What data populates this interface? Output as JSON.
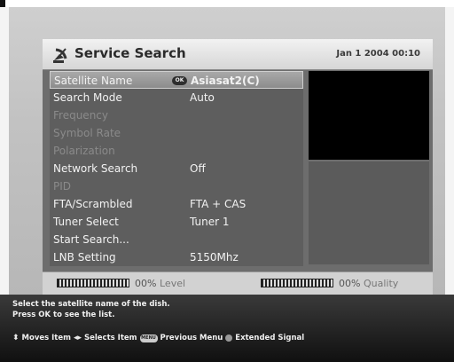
{
  "header": {
    "title": "Service Search",
    "datetime": "Jan 1 2004 00:10",
    "icon": "satellite-dish-icon"
  },
  "menu": {
    "ok_badge": "OK",
    "items": [
      {
        "label": "Satellite Name",
        "value": "Asiasat2(C)",
        "state": "selected"
      },
      {
        "label": "Search Mode",
        "value": "Auto",
        "state": "enabled"
      },
      {
        "label": "Frequency",
        "value": "",
        "state": "disabled"
      },
      {
        "label": "Symbol Rate",
        "value": "",
        "state": "disabled"
      },
      {
        "label": "Polarization",
        "value": "",
        "state": "disabled"
      },
      {
        "label": "Network Search",
        "value": "Off",
        "state": "enabled"
      },
      {
        "label": "PID",
        "value": "",
        "state": "disabled"
      },
      {
        "label": "FTA/Scrambled",
        "value": "FTA + CAS",
        "state": "enabled"
      },
      {
        "label": "Tuner Select",
        "value": "Tuner 1",
        "state": "enabled"
      },
      {
        "label": "Start Search...",
        "value": "",
        "state": "enabled"
      },
      {
        "label": "LNB Setting",
        "value": "5150Mhz",
        "state": "enabled"
      }
    ]
  },
  "meters": {
    "level": {
      "percent": "00%",
      "label": "Level",
      "fill_fraction": 0
    },
    "quality": {
      "percent": "00%",
      "label": "Quality",
      "fill_fraction": 0
    }
  },
  "help": {
    "line1": "Select the satellite name of the dish.",
    "line2": "Press OK to see the list.",
    "moves": "Moves Item",
    "selects": "Selects Item",
    "menu_key": "MENU",
    "previous": "Previous Menu",
    "extended": "Extended Signal"
  },
  "colors": {
    "selected_row": "#9a9a9a",
    "menu_bg": "#5e5e5e",
    "preview": "#000000"
  }
}
